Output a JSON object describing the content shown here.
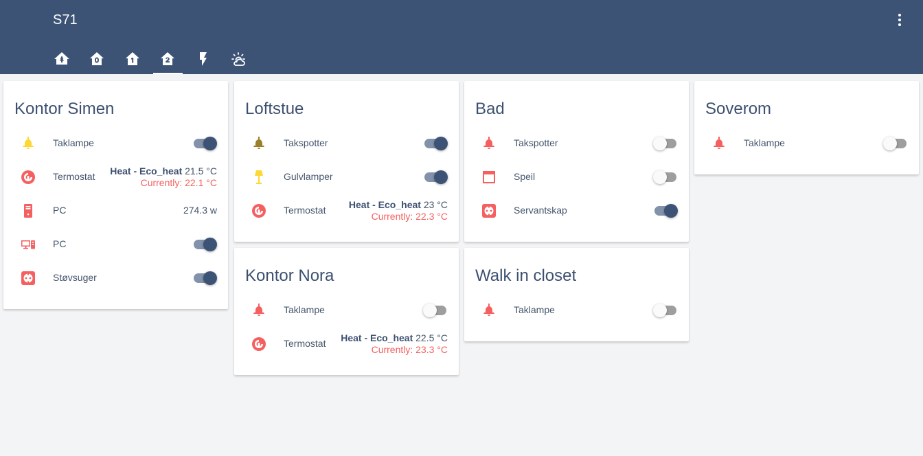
{
  "app": {
    "title": "S71"
  },
  "tabs": [
    {
      "icon": "home-tree-icon",
      "active": false
    },
    {
      "icon": "floor-0-icon",
      "active": false
    },
    {
      "icon": "floor-1-icon",
      "active": false
    },
    {
      "icon": "floor-2-icon",
      "active": true
    },
    {
      "icon": "flash-icon",
      "active": false
    },
    {
      "icon": "weather-partly-cloudy-icon",
      "active": false
    }
  ],
  "colors": {
    "header": "#3c5375",
    "accent_red": "#f55f5f",
    "lamp_yellow": "#fdd835",
    "lamp_olive": "#9a7f2c"
  },
  "cards": {
    "kontor_simen": {
      "title": "Kontor Simen",
      "rows": [
        {
          "icon": "ceiling-lamp-icon",
          "label": "Taklampe",
          "toggle": "on"
        },
        {
          "icon": "thermostat-icon",
          "label": "Termostat",
          "mode": "Heat - Eco_heat",
          "target": "21.5 °C",
          "current": "Currently: 22.1 °C"
        },
        {
          "icon": "desktop-tower-icon",
          "label": "PC",
          "value": "274.3 w"
        },
        {
          "icon": "desktop-classic-icon",
          "label": "PC",
          "toggle": "on"
        },
        {
          "icon": "power-socket-icon",
          "label": "Støvsuger",
          "toggle": "on"
        }
      ]
    },
    "loftstue": {
      "title": "Loftstue",
      "rows": [
        {
          "icon": "ceiling-lamp-icon",
          "label": "Takspotter",
          "toggle": "on"
        },
        {
          "icon": "floor-lamp-icon",
          "label": "Gulvlamper",
          "toggle": "on"
        },
        {
          "icon": "thermostat-icon",
          "label": "Termostat",
          "mode": "Heat - Eco_heat",
          "target": "23 °C",
          "current": "Currently: 22.3 °C"
        }
      ]
    },
    "kontor_nora": {
      "title": "Kontor Nora",
      "rows": [
        {
          "icon": "ceiling-lamp-icon",
          "label": "Taklampe",
          "toggle": "off"
        },
        {
          "icon": "thermostat-icon",
          "label": "Termostat",
          "mode": "Heat - Eco_heat",
          "target": "22.5 °C",
          "current": "Currently: 23.3 °C"
        }
      ]
    },
    "bad": {
      "title": "Bad",
      "rows": [
        {
          "icon": "ceiling-lamp-icon",
          "label": "Takspotter",
          "toggle": "off"
        },
        {
          "icon": "mirror-icon",
          "label": "Speil",
          "toggle": "off"
        },
        {
          "icon": "power-socket-icon",
          "label": "Servantskap",
          "toggle": "on"
        }
      ]
    },
    "walk_in_closet": {
      "title": "Walk in closet",
      "rows": [
        {
          "icon": "ceiling-lamp-icon",
          "label": "Taklampe",
          "toggle": "off"
        }
      ]
    },
    "soverom": {
      "title": "Soverom",
      "rows": [
        {
          "icon": "ceiling-lamp-icon",
          "label": "Taklampe",
          "toggle": "off"
        }
      ]
    }
  }
}
